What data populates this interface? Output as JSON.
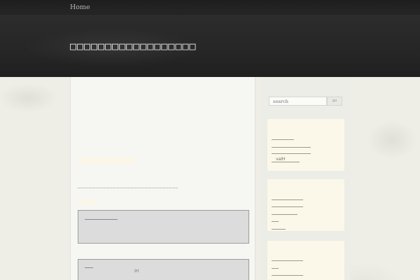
{
  "nav": {
    "home_label": "Home"
  },
  "header": {
    "site_title": "□□□□□□□□□□□□□□□□□□"
  },
  "content": {
    "comments": [
      {
        "snippet": ""
      },
      {
        "snippet": "IH"
      }
    ]
  },
  "sidebar": {
    "search": {
      "placeholder": "search",
      "button_label": "go"
    },
    "widgets": [
      {
        "label": "valH"
      },
      {
        "label": ""
      },
      {
        "label": ""
      }
    ]
  },
  "colors": {
    "header_bg": "#262626",
    "page_bg": "#eeeee7",
    "widget_bg": "#fbf8ea",
    "comment_bg": "#dcdcdc"
  }
}
